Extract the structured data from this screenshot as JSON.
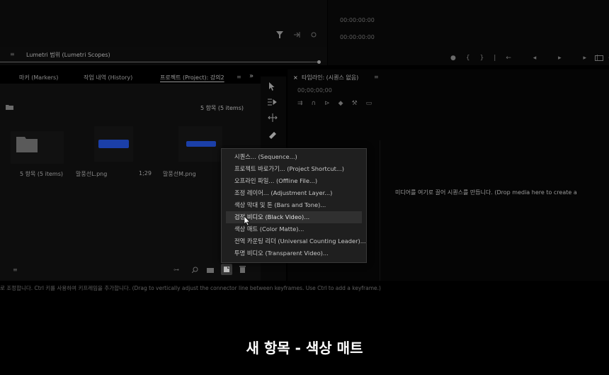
{
  "colors": {
    "background": "#000000",
    "menu_bg": "#1f1f1f",
    "menu_highlight": "#303030",
    "thumb_blue": "#1b3fa8"
  },
  "top_right": {
    "timecode_top": "00:00:00:00",
    "timecode_right": "00:00:00:00",
    "timeline_timecode": "00;00;00;00"
  },
  "lumetri": {
    "tab_label": "Lumetri 범위 (Lumetri Scopes)"
  },
  "tabs": [
    {
      "label": "마커 (Markers)"
    },
    {
      "label": "작업 내역 (History)"
    },
    {
      "label": "프로젝트 (Project): 강의2"
    }
  ],
  "more_tabs": "»",
  "project": {
    "item_count": "5 항목 (5 items)",
    "thumbnails": [
      {
        "name": "5 항목 (5 items)",
        "kind": "folder"
      },
      {
        "name": "말풍선L.png",
        "kind": "image"
      },
      {
        "name": "1;29",
        "kind": "duration"
      },
      {
        "name": "말풍선M.png",
        "kind": "image"
      }
    ]
  },
  "timeline": {
    "title": "타임라인: (시퀀스 없음)",
    "drop_hint": "미디어를 여기로 끌어 시퀀스를 만듭니다. (Drop media here to create a"
  },
  "context_menu": {
    "items": [
      {
        "label": "시퀀스... (Sequence...)"
      },
      {
        "label": "프로젝트 바로가기... (Project Shortcut...)"
      },
      {
        "label": "오프라인 파일... (Offline File...)"
      },
      {
        "label": "조정 레이어... (Adjustment Layer...)"
      },
      {
        "label": "색상 막대 및 톤 (Bars and Tone)..."
      },
      {
        "label": "검정 비디오 (Black Video)...",
        "highlighted": true
      },
      {
        "label": "색상 매트 (Color Matte)..."
      },
      {
        "label": "전역 카운팅 리더 (Universal Counting Leader)..."
      },
      {
        "label": "투명 비디오 (Transparent Video)..."
      }
    ]
  },
  "status_bar": "로 조정합니다. Ctrl 키를 사용하여 키프레임을 추가합니다. (Drag to vertically adjust the connector line between keyframes. Use Ctrl to add a keyframe.)",
  "caption": "새 항목 - 색상 매트",
  "icons": [
    "funnel-icon",
    "export-icon",
    "wrench-icon",
    "selection-tool-icon",
    "track-select-icon",
    "ripple-edit-icon",
    "razor-icon",
    "list-view-icon",
    "search-icon",
    "new-bin-icon",
    "new-item-icon",
    "trash-icon",
    "folder-icon",
    "play-icon"
  ]
}
